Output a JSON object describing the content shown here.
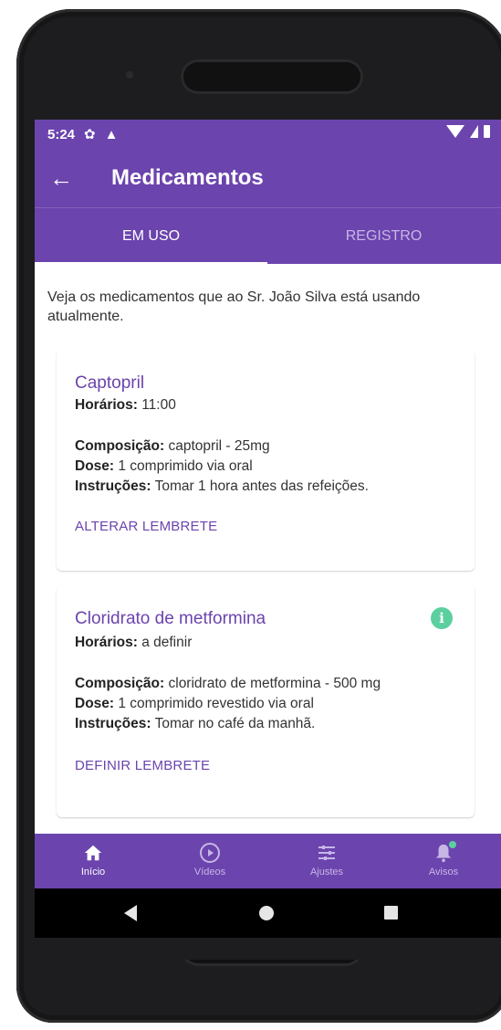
{
  "status_bar": {
    "time": "5:24",
    "icons": [
      "gear-icon",
      "warning-icon",
      "wifi-icon",
      "signal-icon",
      "battery-icon"
    ]
  },
  "app_bar": {
    "title": "Medicamentos",
    "back_icon": "arrow-back-icon"
  },
  "tabs": [
    {
      "label": "EM USO",
      "active": true
    },
    {
      "label": "REGISTRO",
      "active": false
    }
  ],
  "intro": "Veja os medicamentos que ao Sr. João Silva está usando atualmente.",
  "medications": [
    {
      "name": "Captopril",
      "schedule_label": "Horários:",
      "schedule_value": " 11:00",
      "composition_label": "Composição:",
      "composition_value": " captopril - 25mg",
      "dose_label": "Dose:",
      "dose_value": " 1 comprimido via oral",
      "instructions_label": "Instruções:",
      "instructions_value": " Tomar 1 hora antes das refeições.",
      "action": "ALTERAR LEMBRETE"
    },
    {
      "name": "Cloridrato de metformina",
      "schedule_label": "Horários:",
      "schedule_value": " a definir",
      "composition_label": "Composição:",
      "composition_value": " cloridrato de metformina - 500 mg",
      "dose_label": "Dose:",
      "dose_value": " 1 comprimido revestido via oral",
      "instructions_label": "Instruções:",
      "instructions_value": " Tomar no café da manhã.",
      "action": "DEFINIR LEMBRETE",
      "info_icon": "info-icon"
    }
  ],
  "bottom_nav": [
    {
      "label": "Início",
      "icon": "home-icon",
      "active": true
    },
    {
      "label": "Vídeos",
      "icon": "play-circle-icon",
      "active": false
    },
    {
      "label": "Ajustes",
      "icon": "sliders-icon",
      "active": false
    },
    {
      "label": "Avisos",
      "icon": "bell-icon",
      "active": false
    }
  ],
  "colors": {
    "primary": "#6b44ad",
    "accent": "#5ccf9e"
  }
}
